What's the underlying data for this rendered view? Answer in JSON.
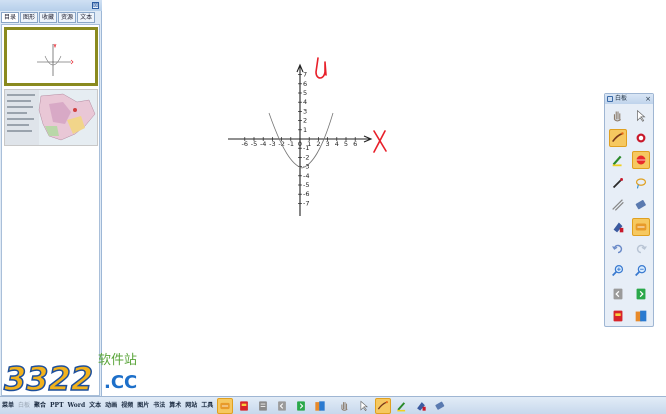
{
  "left_panel": {
    "tabs": [
      "目录",
      "图形",
      "收藏",
      "资源",
      "文本"
    ],
    "active_tab_index": 0,
    "pin_glyph": "⊠",
    "thumbnails": [
      {
        "name": "thumb-parabola",
        "selected": true
      },
      {
        "name": "thumb-map",
        "selected": false
      }
    ]
  },
  "canvas": {
    "x_axis": {
      "ticks": [
        "-6",
        "-5",
        "-4",
        "-3",
        "-2",
        "-1",
        "0",
        "1",
        "2",
        "3",
        "4",
        "5",
        "6"
      ],
      "handwritten_label": "X"
    },
    "y_axis": {
      "ticks_positive": [
        "7",
        "6",
        "5",
        "4",
        "3",
        "2",
        "1"
      ],
      "ticks_negative": [
        "-1",
        "-2",
        "-3",
        "-4",
        "-5",
        "-6",
        "-7"
      ],
      "handwritten_label": "y"
    },
    "curve_color": "#777777",
    "annotation_color": "#e8202a"
  },
  "toolbox": {
    "title": "白板",
    "close_glyph": "×",
    "tools": [
      {
        "name": "hand-icon",
        "active": false
      },
      {
        "name": "pointer-icon",
        "active": false
      },
      {
        "name": "pen-icon",
        "active": true
      },
      {
        "name": "record-icon",
        "active": false
      },
      {
        "name": "highlighter-icon",
        "active": false
      },
      {
        "name": "laser-pointer-icon",
        "active": true
      },
      {
        "name": "brush-icon",
        "active": false
      },
      {
        "name": "lasso-icon",
        "active": false
      },
      {
        "name": "line-tool-icon",
        "active": false
      },
      {
        "name": "eraser-icon",
        "active": false
      },
      {
        "name": "fill-icon",
        "active": false
      },
      {
        "name": "scroll-icon",
        "active": true
      },
      {
        "name": "undo-icon",
        "active": false
      },
      {
        "name": "redo-icon",
        "active": false
      },
      {
        "name": "zoom-in-icon",
        "active": false
      },
      {
        "name": "zoom-out-icon",
        "active": false
      },
      {
        "name": "prev-page-icon",
        "active": false
      },
      {
        "name": "next-page-icon",
        "active": false
      },
      {
        "name": "red-book-icon",
        "active": false
      },
      {
        "name": "blue-book-icon",
        "active": false
      }
    ]
  },
  "bottom_bar": {
    "menu_items": [
      {
        "label": "菜单",
        "disabled": false
      },
      {
        "label": "白板",
        "disabled": true
      },
      {
        "label": "聚合",
        "disabled": false
      },
      {
        "label": "PPT",
        "disabled": false
      },
      {
        "label": "Word",
        "disabled": false
      },
      {
        "label": "文本",
        "disabled": false
      },
      {
        "label": "动画",
        "disabled": false
      },
      {
        "label": "视频",
        "disabled": false
      },
      {
        "label": "图片",
        "disabled": false
      },
      {
        "label": "书法",
        "disabled": false
      },
      {
        "label": "算术",
        "disabled": false
      },
      {
        "label": "网站",
        "disabled": false
      },
      {
        "label": "工具",
        "disabled": false
      }
    ],
    "icons": [
      {
        "name": "scroll-icon",
        "active": true
      },
      {
        "name": "red-book-icon",
        "active": false
      },
      {
        "name": "gray-page-icon",
        "active": false
      },
      {
        "name": "prev-page-icon",
        "active": false
      },
      {
        "name": "next-page-icon",
        "active": false
      },
      {
        "name": "blue-book-icon",
        "active": false
      },
      {
        "name": "hand-icon",
        "active": false
      },
      {
        "name": "pointer-icon",
        "active": false
      },
      {
        "name": "pen-icon",
        "active": true
      },
      {
        "name": "highlighter-icon",
        "active": false
      },
      {
        "name": "fill-icon",
        "active": false
      },
      {
        "name": "eraser-icon",
        "active": false
      }
    ]
  },
  "watermark": {
    "number": "3322",
    "suffix": ".CC",
    "tagline": "软件站"
  }
}
